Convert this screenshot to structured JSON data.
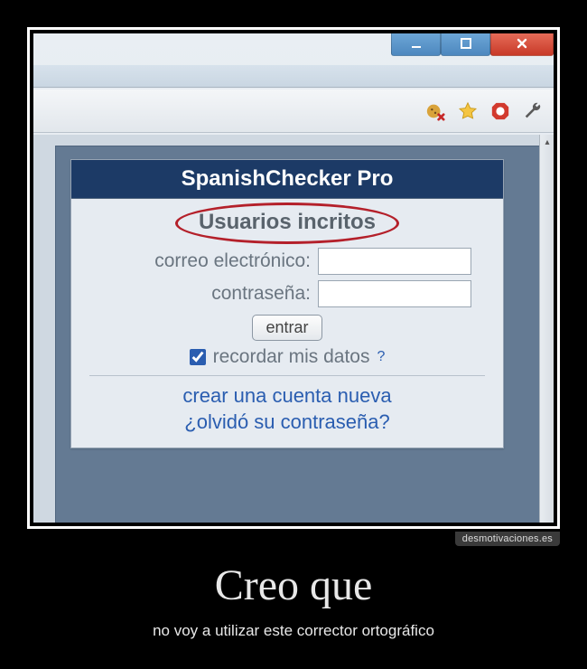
{
  "window": {
    "minimize": "–",
    "maximize": "□",
    "close": "×"
  },
  "toolbar": {
    "icons": [
      "cookie-block-icon",
      "star-icon",
      "adblock-icon",
      "wrench-icon"
    ]
  },
  "login": {
    "title": "SpanishChecker Pro",
    "subheader": "Usuarios incritos",
    "email_label": "correo electrónico:",
    "password_label": "contraseña:",
    "submit_label": "entrar",
    "remember_label": "recordar mis datos",
    "remember_checked": true,
    "help_symbol": "?",
    "create_link": "crear una cuenta nueva",
    "forgot_link": "¿olvidó su contraseña?"
  },
  "watermark": "desmotivaciones.es",
  "caption": {
    "title": "Creo que",
    "subtitle": "no voy a utilizar este corrector ortográfico"
  }
}
